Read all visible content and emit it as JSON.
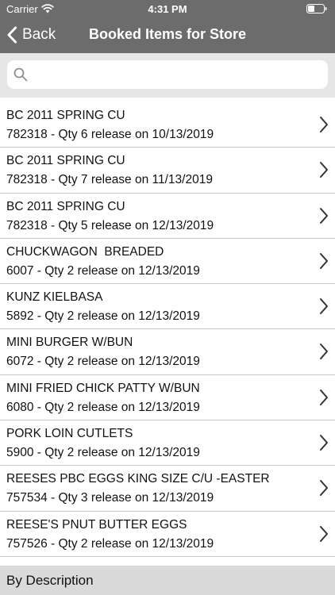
{
  "status_bar": {
    "carrier": "Carrier",
    "time": "4:31 PM",
    "wifi_icon": "wifi-icon",
    "battery_icon": "battery-icon"
  },
  "nav": {
    "back_label": "Back",
    "back_icon": "chevron-left-icon",
    "title": "Booked Items for Store"
  },
  "search": {
    "icon": "search-icon",
    "value": "",
    "placeholder": ""
  },
  "items": [
    {
      "line1": "BC 2011 SPRING CU",
      "line2": "782318 - Qty 6 release on 10/13/2019"
    },
    {
      "line1": "BC 2011 SPRING CU",
      "line2": "782318 - Qty 7 release on 11/13/2019"
    },
    {
      "line1": "BC 2011 SPRING CU",
      "line2": "782318 - Qty 5 release on 12/13/2019"
    },
    {
      "line1": "CHUCKWAGON  BREADED",
      "line2": "6007 - Qty 2 release on 12/13/2019"
    },
    {
      "line1": "KUNZ KIELBASA",
      "line2": "5892 - Qty 2 release on 12/13/2019"
    },
    {
      "line1": "MINI BURGER W/BUN",
      "line2": "6072 - Qty 2 release on 12/13/2019"
    },
    {
      "line1": "MINI FRIED CHICK PATTY W/BUN",
      "line2": "6080 - Qty 2 release on 12/13/2019"
    },
    {
      "line1": "PORK LOIN CUTLETS",
      "line2": "5900 - Qty 2 release on 12/13/2019"
    },
    {
      "line1": "REESES PBC EGGS KING SIZE C/U -EASTER",
      "line2": "757534 - Qty 3 release on 12/13/2019"
    },
    {
      "line1": "REESE'S PNUT BUTTER EGGS",
      "line2": "757526 - Qty 2 release on 12/13/2019"
    }
  ],
  "footer": {
    "label": "By Description"
  },
  "colors": {
    "header_bg": "#6c6c6c",
    "search_bg": "#e6e6e6",
    "footer_bg": "#dadada",
    "separator": "#c8c7cc",
    "chevron": "#333333"
  }
}
